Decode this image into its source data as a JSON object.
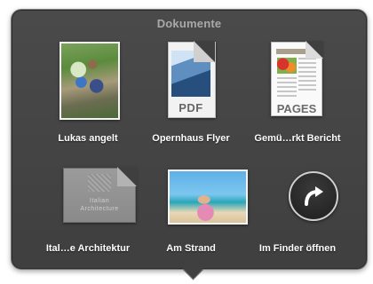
{
  "stack": {
    "title": "Dokumente",
    "items": [
      {
        "label": "Lukas angelt"
      },
      {
        "label": "Opernhaus Flyer",
        "tag": "PDF"
      },
      {
        "label": "Gemü…rkt Bericht",
        "tag": "PAGES"
      },
      {
        "label": "Ital…e Architektur",
        "caption": "Italian\nArchitecture"
      },
      {
        "label": "Am Strand"
      },
      {
        "label": "Im Finder öffnen",
        "icon": "curved-arrow-icon"
      }
    ]
  }
}
